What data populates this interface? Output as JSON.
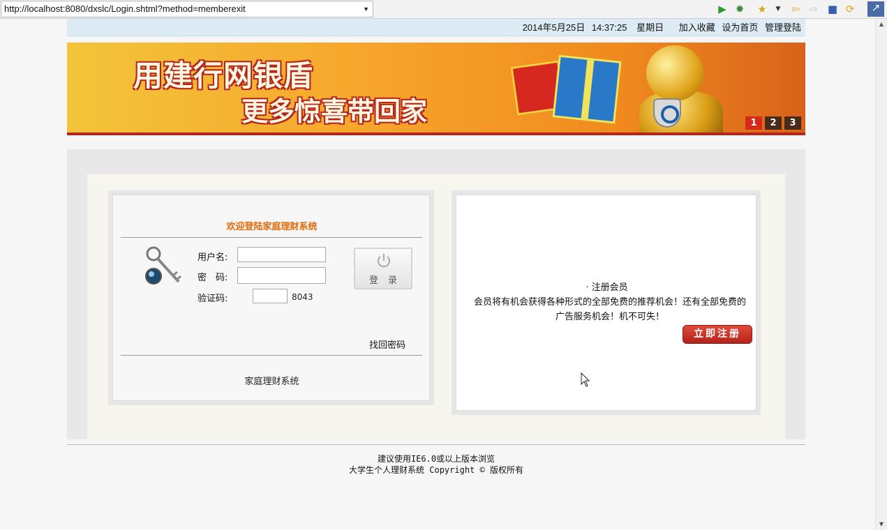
{
  "browser": {
    "url": "http://localhost:8080/dxslc/Login.shtml?method=memberexit",
    "url_dropdown": "▼",
    "icons": [
      "run-icon",
      "debug-icon",
      "favorites-icon",
      "back-icon",
      "forward-icon",
      "stop-icon",
      "refresh-icon",
      "eclipse-icon"
    ]
  },
  "topbar": {
    "date": "2014年5月25日",
    "time": "14:37:25",
    "weekday": "星期日",
    "add_favorite": "加入收藏",
    "set_homepage": "设为首页",
    "admin_login": "管理登陆"
  },
  "banner": {
    "line1": "用建行网银盾",
    "line2": "更多惊喜带回家",
    "pages": [
      "1",
      "2",
      "3"
    ],
    "active_page": "1"
  },
  "login": {
    "title": "欢迎登陆家庭理财系统",
    "username_label": "用户名:",
    "password_label": "密　码:",
    "captcha_label": "验证码:",
    "captcha_code": "8043",
    "username_value": "",
    "password_value": "",
    "captcha_value": "",
    "login_button": "登录",
    "find_password": "找回密码",
    "footer": "家庭理财系统"
  },
  "register": {
    "title": "· 注册会员",
    "description": "会员将有机会获得各种形式的全部免费的推荐机会！还有全部免费的广告服务机会！机不可失！",
    "button": "立即注册"
  },
  "footer": {
    "line1": "建议使用IE6.0或以上版本浏览",
    "line2": "大学生个人理财系统 Copyright © 版权所有"
  },
  "colors": {
    "title_orange": "#e36a0a",
    "topbar_bg": "#dcebf4",
    "register_red": "#b3231a"
  }
}
